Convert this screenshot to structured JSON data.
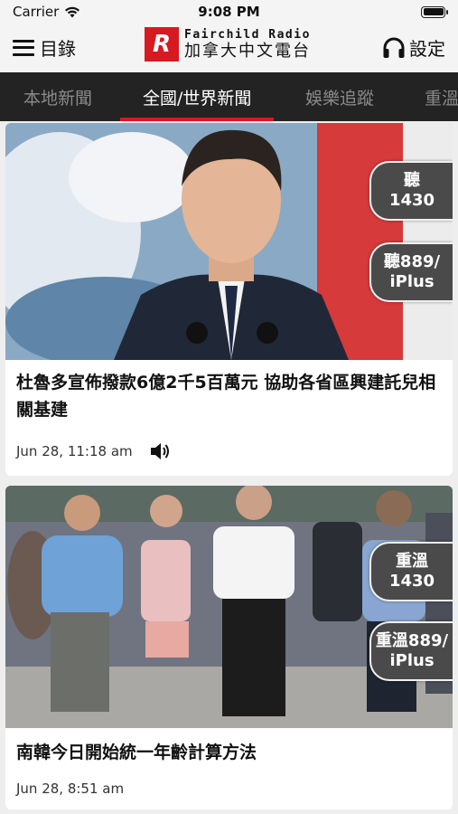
{
  "status": {
    "carrier": "Carrier",
    "time": "9:08 PM"
  },
  "header": {
    "menu_label": "目錄",
    "logo_en": "Fairchild Radio",
    "logo_zh": "加拿大中文電台",
    "logo_mark": "R",
    "settings_label": "設定"
  },
  "tabs": [
    {
      "label": "本地新聞",
      "active": false
    },
    {
      "label": "全國/世界新聞",
      "active": true
    },
    {
      "label": "娛樂追蹤",
      "active": false
    },
    {
      "label": "重溫",
      "active": false
    }
  ],
  "articles": [
    {
      "title": "杜魯多宣佈撥款6億2千5百萬元  協助各省區興建託兒相關基建",
      "time": "Jun 28, 11:18 am",
      "has_audio": true
    },
    {
      "title": "南韓今日開始統一年齡計算方法",
      "time": "Jun 28, 8:51 am",
      "has_audio": false
    }
  ],
  "radio_buttons": [
    {
      "line1": "聽",
      "line2": "1430"
    },
    {
      "line1": "聽889/",
      "line2": "iPlus"
    },
    {
      "line1": "重溫",
      "line2": "1430"
    },
    {
      "line1": "重溫889/",
      "line2": "iPlus"
    }
  ],
  "colors": {
    "brand_red": "#d71920",
    "tab_bg": "#232323",
    "radio_btn_bg": "#4a4a4a"
  }
}
